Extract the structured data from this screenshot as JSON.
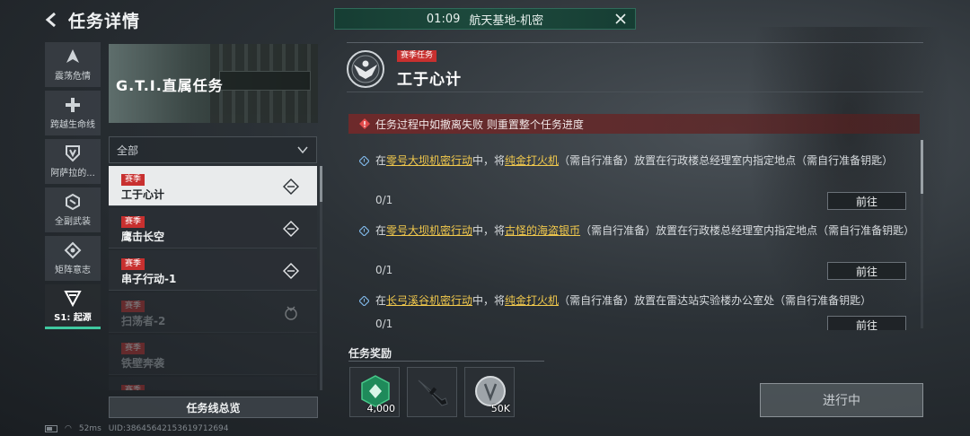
{
  "header": {
    "title": "任务详情"
  },
  "timer": {
    "time": "01:09",
    "location": "航天基地-机密"
  },
  "rail": {
    "items": [
      {
        "label": "震荡危情"
      },
      {
        "label": "跨越生命线"
      },
      {
        "label": "阿萨拉的..."
      },
      {
        "label": "全副武装"
      },
      {
        "label": "矩阵意志"
      },
      {
        "label": "S1: 起源"
      }
    ]
  },
  "banner": {
    "title": "G.T.I.直属任务"
  },
  "filter": {
    "selected": "全部"
  },
  "tasks": [
    {
      "tag": "赛季",
      "name": "工于心计"
    },
    {
      "tag": "赛季",
      "name": "鹰击长空"
    },
    {
      "tag": "赛季",
      "name": "串子行动-1"
    },
    {
      "tag": "赛季",
      "name": "扫荡者-2"
    },
    {
      "tag": "赛季",
      "name": "铁壁奔袭"
    },
    {
      "tag": "赛季",
      "name": ""
    }
  ],
  "overview_button": "任务线总览",
  "status": {
    "ping": "52ms",
    "uid": "UID:3864564215361971269​4"
  },
  "mission": {
    "tag": "赛季任务",
    "title": "工于心计",
    "warning": "任务过程中如撤离失败 则重置整个任务进度",
    "objectives": [
      {
        "pre": "在",
        "loc": "零号大坝机密行动",
        "mid": "中，将",
        "item": "纯金打火机",
        "post": "（需自行准备）放置在行政楼总经理室内指定地点（需自行准备钥匙）",
        "progress": "0/1",
        "button": "前往"
      },
      {
        "pre": "在",
        "loc": "零号大坝机密行动",
        "mid": "中，将",
        "item": "古怪的海盗银币",
        "post": "（需自行准备）放置在行政楼总经理室内指定地点（需自行准备钥匙）",
        "progress": "0/1",
        "button": "前往"
      },
      {
        "pre": "在",
        "loc": "长弓溪谷机密行动",
        "mid": "中，将",
        "item": "纯金打火机",
        "post": "（需自行准备）放置在雷达站实验楼办公室处（需自行准备钥匙）",
        "progress": "0/1",
        "button": "前往"
      }
    ]
  },
  "rewards": {
    "title": "任务奖励",
    "items": [
      {
        "icon": "currency-chip-icon",
        "amount": "4,000"
      },
      {
        "icon": "rifle-icon",
        "amount": ""
      },
      {
        "icon": "silver-coin-icon",
        "amount": "50K"
      }
    ]
  },
  "action_button": "进行中",
  "colors": {
    "accent": "#3fc9a0",
    "tag_red": "#c8302f",
    "highlight": "#f2c94c"
  }
}
